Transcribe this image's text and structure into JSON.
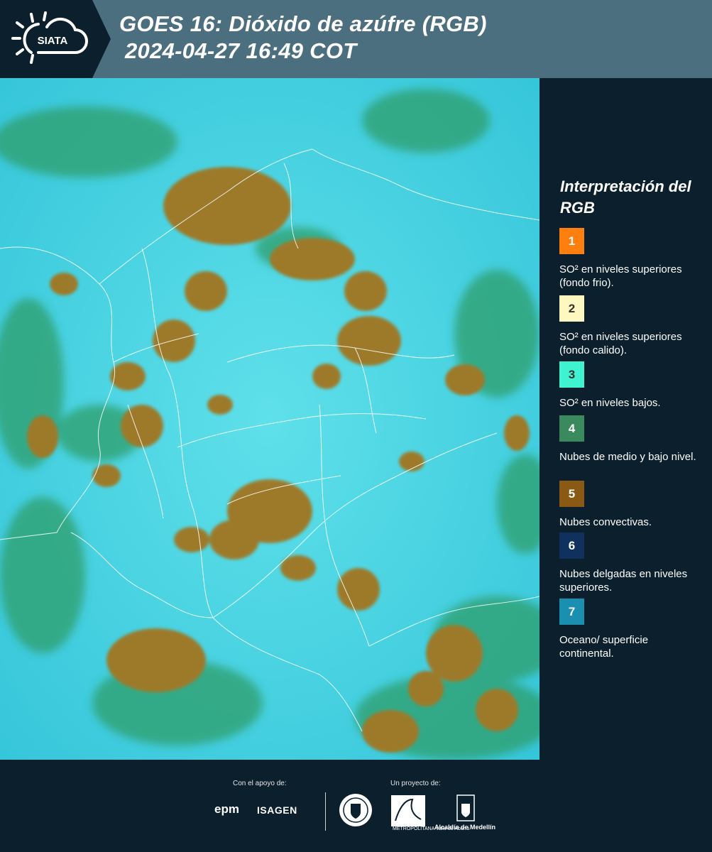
{
  "header": {
    "logo_text": "SIATA",
    "title_line1": "GOES 16: Dióxido de azúfre (RGB)",
    "title_line2": "2024-04-27 16:49 COT"
  },
  "map": {
    "image_kind": "satellite-rgb-composite",
    "colors": {
      "background": "#3ecfe0",
      "convective_cloud": "#9c7a2a",
      "low_cloud": "#2f9e6a",
      "border_lines": "#ffffff"
    }
  },
  "legend": {
    "title": "Interpretación del RGB",
    "items": [
      {
        "number": "1",
        "color": "#ff7f0e",
        "number_color": "#ffffff",
        "label": "SO² en niveles superiores (fondo frio)."
      },
      {
        "number": "2",
        "color": "#fff7c0",
        "number_color": "#333333",
        "label": "SO² en niveles superiores (fondo calido)."
      },
      {
        "number": "3",
        "color": "#3ff2d0",
        "number_color": "#333333",
        "label": "SO² en niveles bajos."
      },
      {
        "number": "4",
        "color": "#3a8a5e",
        "number_color": "#ffffff",
        "label": "Nubes de medio y bajo nivel."
      },
      {
        "number": "5",
        "color": "#8a5a14",
        "number_color": "#ffffff",
        "label": "Nubes convectivas."
      },
      {
        "number": "6",
        "color": "#10305e",
        "number_color": "#ffffff",
        "label": "Nubes delgadas en niveles superiores."
      },
      {
        "number": "7",
        "color": "#1b8fb0",
        "number_color": "#ffffff",
        "label": "Oceano/ superficie continental."
      }
    ]
  },
  "footer": {
    "support_label": "Con el apoyo de:",
    "project_label": "Un proyecto de:",
    "sponsor_1": "epm",
    "sponsor_2": "ISAGEN",
    "partner_1": "Universidad Nacional / Medellín seal",
    "partner_2": "METROPOLITANA Valle de Aburrá",
    "partner_3": "Alcaldía de Medellín"
  }
}
